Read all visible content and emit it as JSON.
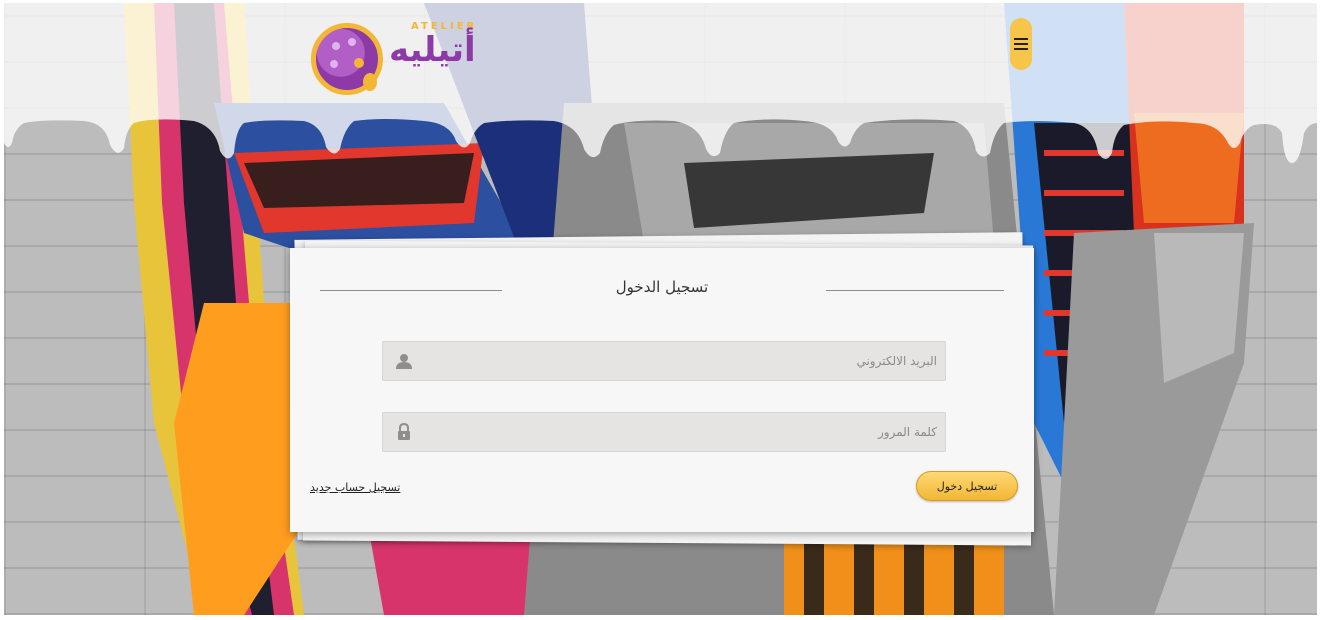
{
  "brand": {
    "logo_text": "أتيليه",
    "logo_subtext": "ATELIER"
  },
  "header": {
    "menu_icon": "hamburger-menu-icon"
  },
  "login": {
    "title": "تسجيل الدخول",
    "email_placeholder": "البريد الالكتروني",
    "email_icon": "user-icon",
    "password_placeholder": "كلمة المرور",
    "password_icon": "lock-icon",
    "submit_label": "تسجيل دخول",
    "register_label": "تسجيل حساب جديد"
  },
  "colors": {
    "accent": "#f2b735",
    "brand_purple": "#8d3aa6",
    "card_bg": "#f7f7f7"
  }
}
